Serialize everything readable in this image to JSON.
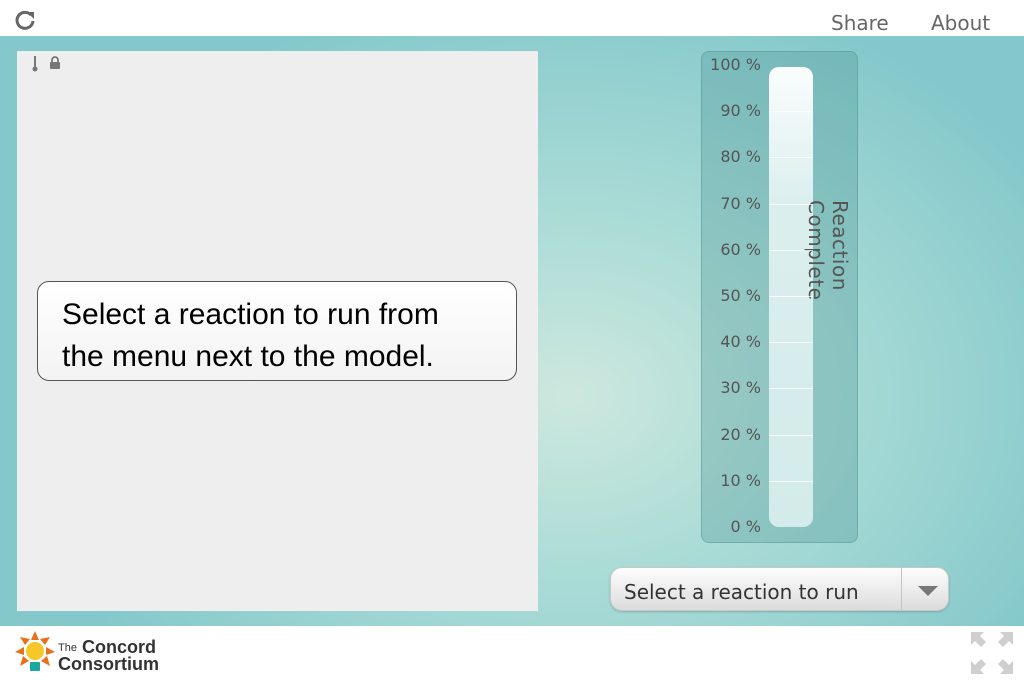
{
  "header": {
    "share_label": "Share",
    "about_label": "About",
    "reload_icon": "reload-icon"
  },
  "model": {
    "message_line1": "Select a reaction to run from",
    "message_line2": "the menu next to the model.",
    "icons": [
      "thermometer-icon",
      "lock-icon"
    ]
  },
  "gauge": {
    "title": "Reaction Complete",
    "ticks": [
      "100 %",
      "90 %",
      "80 %",
      "70 %",
      "60 %",
      "50 %",
      "40 %",
      "30 %",
      "20 %",
      "10 %",
      "0 %"
    ],
    "fill_fraction": 1.0
  },
  "reaction_select": {
    "selected": "Select a reaction to run"
  },
  "footer": {
    "brand_line1_small": "The",
    "brand_line1": "Concord",
    "brand_line2": "Consortium",
    "fullscreen_icon": "fullscreen-icon"
  },
  "colors": {
    "background_light": "#cde8de",
    "background_dark": "#84c8cb",
    "model_panel": "#eeeeee",
    "logo_orange": "#e8701a"
  }
}
